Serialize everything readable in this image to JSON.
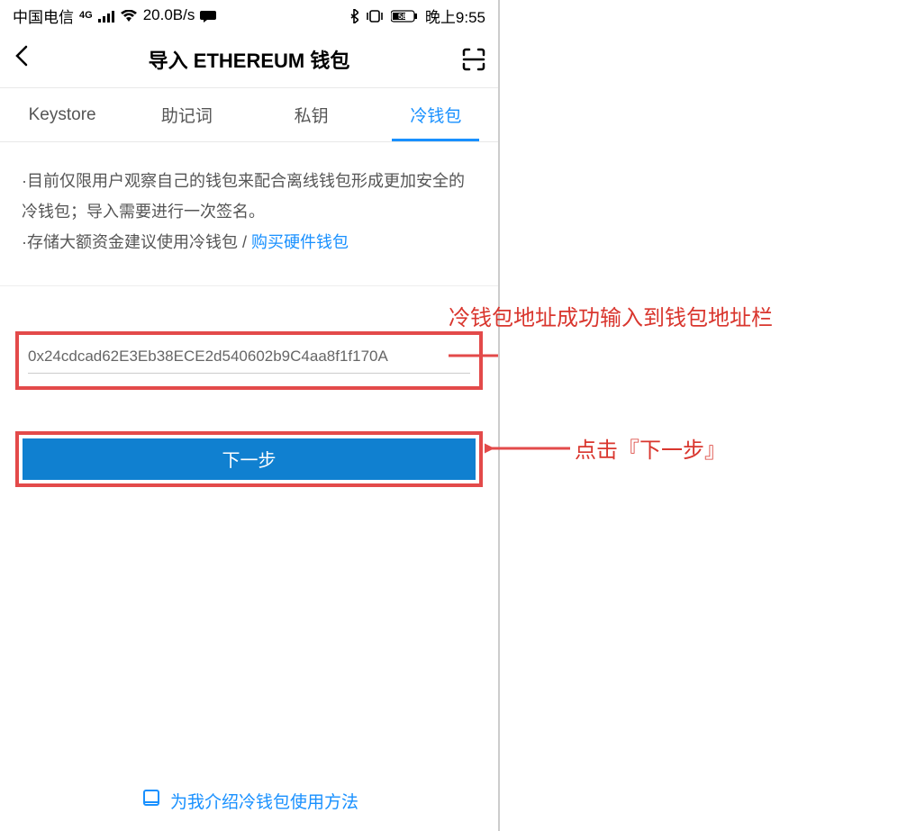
{
  "statusBar": {
    "carrier": "中国电信",
    "signal4g": "4G",
    "speed": "20.0B/s",
    "battery": "58",
    "time": "晚上9:55"
  },
  "nav": {
    "title": "导入 ETHEREUM 钱包"
  },
  "tabs": {
    "keystore": "Keystore",
    "mnemonic": "助记词",
    "privatekey": "私钥",
    "coldwallet": "冷钱包"
  },
  "info": {
    "line1": "·目前仅限用户观察自己的钱包来配合离线钱包形成更加安全的冷钱包；导入需要进行一次签名。",
    "line2_prefix": "·存储大额资金建议使用冷钱包 / ",
    "buy_link": "购买硬件钱包"
  },
  "address": {
    "value": "0x24cdcad62E3Eb38ECE2d540602b9C4aa8f1f170A"
  },
  "buttons": {
    "next": "下一步"
  },
  "footer": {
    "help": "为我介绍冷钱包使用方法"
  },
  "annotations": {
    "address_note": "冷钱包地址成功输入到钱包地址栏",
    "next_note": "点击『下一步』"
  }
}
